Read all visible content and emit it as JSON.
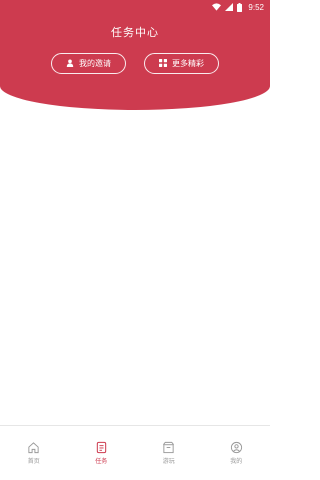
{
  "status_bar": {
    "time": "9:52",
    "icons": [
      "wifi-icon",
      "signal-icon",
      "battery-icon"
    ]
  },
  "header": {
    "title": "任务中心",
    "invite_button": {
      "label": "我的邀请",
      "icon": "person-icon"
    },
    "more_button": {
      "label": "更多精彩",
      "icon": "grid-icon"
    }
  },
  "tabbar": {
    "items": [
      {
        "label": "首页",
        "icon": "home-icon",
        "active": false
      },
      {
        "label": "任务",
        "icon": "task-icon",
        "active": true
      },
      {
        "label": "游玩",
        "icon": "box-icon",
        "active": false
      },
      {
        "label": "我的",
        "icon": "profile-icon",
        "active": false
      }
    ]
  },
  "colors": {
    "accent": "#cd3b4f",
    "inactive": "#999999",
    "background": "#ffffff"
  }
}
